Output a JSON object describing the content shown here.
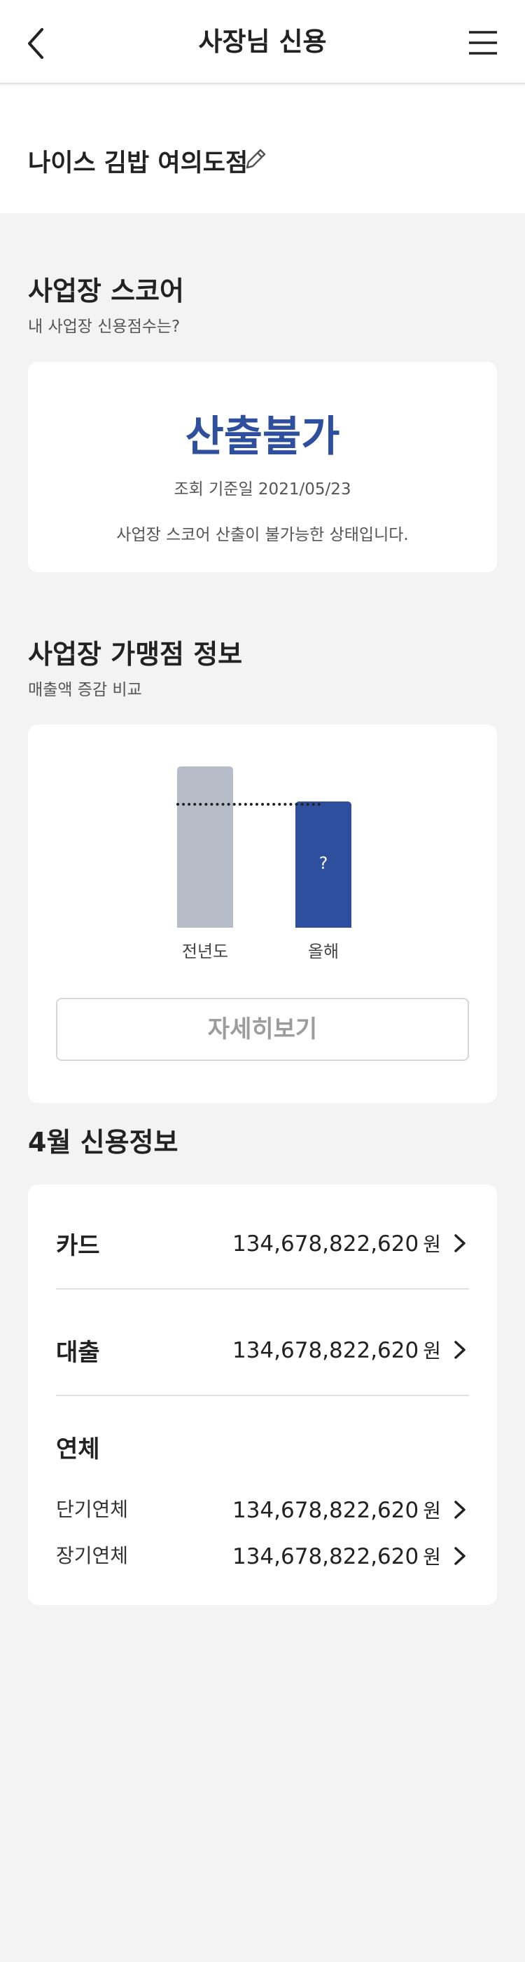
{
  "header": {
    "title": "사장님 신용",
    "back_icon": "chevron-left-icon",
    "menu_icon": "hamburger-menu-icon"
  },
  "store": {
    "name": "나이스 김밥 여의도점",
    "edit_icon": "pencil-icon"
  },
  "business_score": {
    "title": "사업장 스코어",
    "subtitle": "내 사업장 신용점수는?",
    "value": "산출불가",
    "date_text": "조회 기준일 2021/05/23",
    "message": "사업장 스코어 산출이 불가능한 상태입니다."
  },
  "merchant_info": {
    "title": "사업장 가맹점 정보",
    "subtitle": "매출액 증감 비교",
    "chart": {
      "prev_label": "전년도",
      "this_label": "올해",
      "this_value_mark": "?",
      "prev_color": "#b7bdc8",
      "this_color": "#2e4f9d"
    },
    "detail_button": "자세히보기"
  },
  "credit_info": {
    "title": "4월 신용정보",
    "card": {
      "label": "카드",
      "amount": "134,678,822,620",
      "unit": "원"
    },
    "loan": {
      "label": "대출",
      "amount": "134,678,822,620",
      "unit": "원"
    },
    "overdue": {
      "label": "연체",
      "short_term": {
        "label": "단기연체",
        "amount": "134,678,822,620",
        "unit": "원"
      },
      "long_term": {
        "label": "장기연체",
        "amount": "134,678,822,620",
        "unit": "원"
      }
    }
  },
  "colors": {
    "accent": "#2e4f9d",
    "background": "#f3f3f3"
  }
}
